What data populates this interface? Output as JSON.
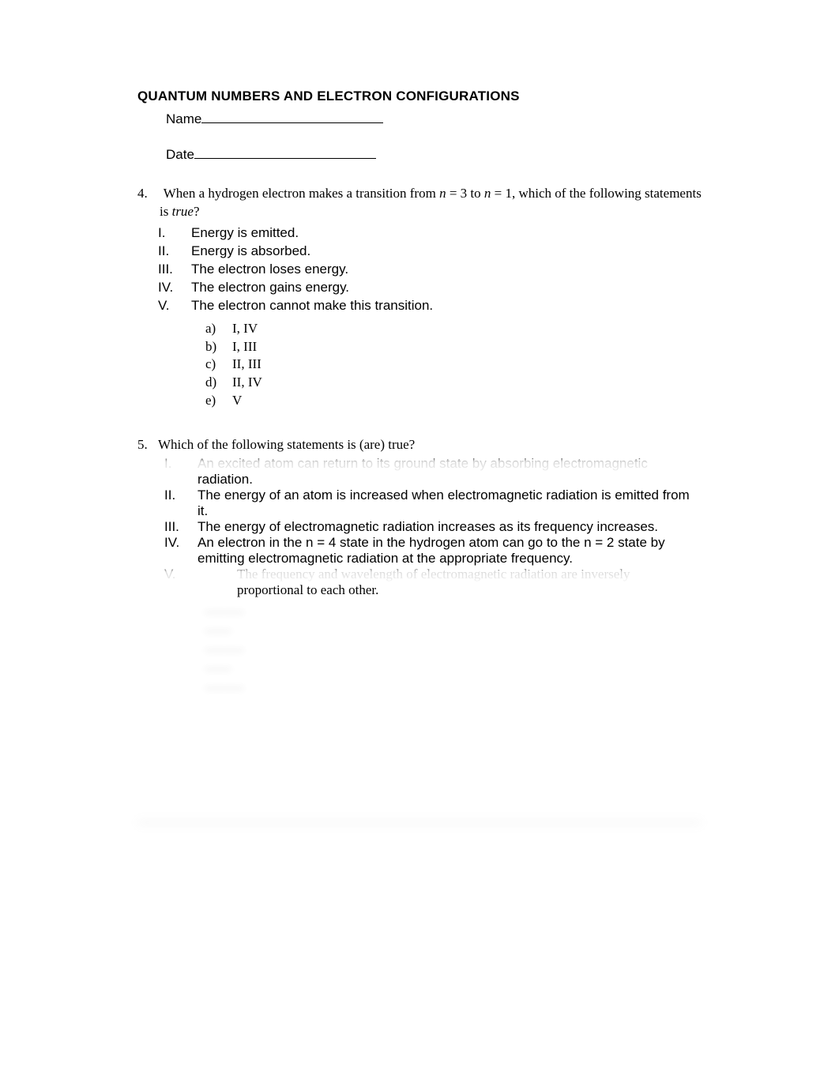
{
  "title": "QUANTUM NUMBERS AND ELECTRON CONFIGURATIONS",
  "fields": {
    "name_label": "Name",
    "date_label": "Date"
  },
  "q4": {
    "number": "4.",
    "stem_prefix": "When a hydrogen electron makes a transition from ",
    "stem_n1_label": "n",
    "stem_eq1": " = 3 to ",
    "stem_n2_label": "n",
    "stem_eq2": " = 1, which of the following statements",
    "stem_line2_prefix": "is ",
    "stem_true": "true",
    "stem_line2_suffix": "?",
    "romans": [
      {
        "rn": "I.",
        "rt": "Energy is emitted."
      },
      {
        "rn": "II.",
        "rt": "Energy is absorbed."
      },
      {
        "rn": "III.",
        "rt": "The electron loses energy."
      },
      {
        "rn": "IV.",
        "rt": "The electron gains energy."
      },
      {
        "rn": "V.",
        "rt": "The electron cannot make this transition."
      }
    ],
    "choices": [
      {
        "cl": "a)",
        "ct": "I, IV"
      },
      {
        "cl": "b)",
        "ct": "I, III"
      },
      {
        "cl": "c)",
        "ct": "II, III"
      },
      {
        "cl": "d)",
        "ct": "II, IV"
      },
      {
        "cl": "e)",
        "ct": "V"
      }
    ]
  },
  "q5": {
    "number": "5.",
    "stem": "Which of the following statements is (are) true?",
    "romans": [
      {
        "rn": "I.",
        "rt": "An excited atom can return to its ground state by absorbing electromagnetic radiation."
      },
      {
        "rn": "II.",
        "rt": "The energy of an atom is increased when electromagnetic radiation is emitted from it."
      },
      {
        "rn": "III.",
        "rt": "The energy of electromagnetic radiation increases as its frequency increases."
      },
      {
        "rn": "IV.",
        "rt": "An electron in the n = 4 state in the hydrogen atom can go to the n = 2 state by emitting electromagnetic radiation at the appropriate frequency."
      },
      {
        "rn": "V.",
        "rt": "The frequency and wavelength of electromagnetic radiation are inversely proportional to each other."
      }
    ],
    "obscured_choices": [
      "———",
      "——",
      "———",
      "——",
      "———"
    ]
  }
}
